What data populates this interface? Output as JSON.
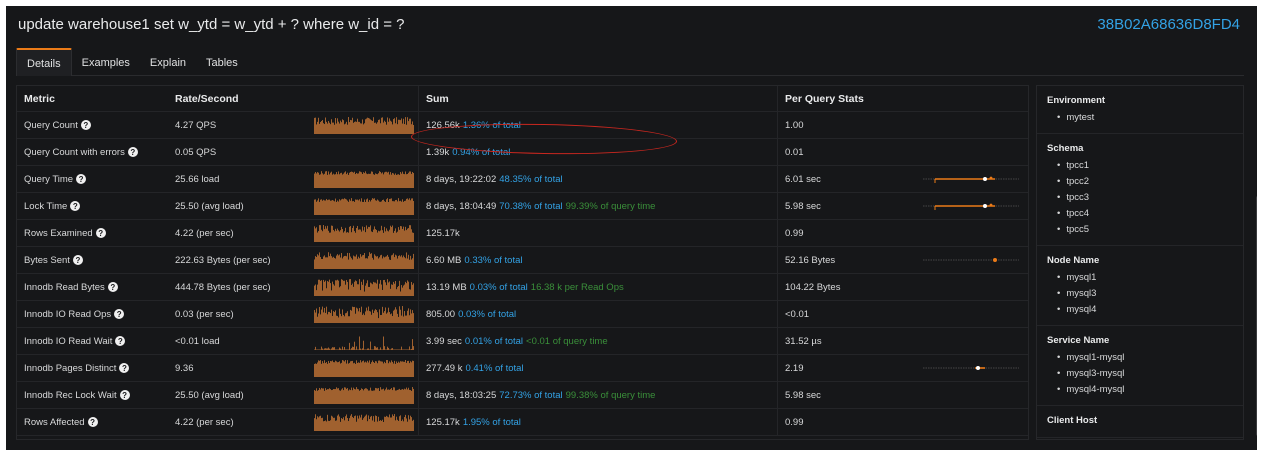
{
  "header": {
    "query_title": "update warehouse1 set w_ytd = w_ytd + ? where w_id = ?",
    "query_id": "38B02A68636D8FD4"
  },
  "tabs": [
    {
      "label": "Details",
      "active": true
    },
    {
      "label": "Examples",
      "active": false
    },
    {
      "label": "Explain",
      "active": false
    },
    {
      "label": "Tables",
      "active": false
    }
  ],
  "table": {
    "columns": {
      "metric": "Metric",
      "rate": "Rate/Second",
      "sum": "Sum",
      "per_query": "Per Query Stats"
    },
    "rows": [
      {
        "metric": "Query Count",
        "rate": "4.27 QPS",
        "sum": "126.56k",
        "sum_pct": "1.36% of total",
        "sum_extra": "",
        "per_query": "1.00",
        "sparkline": "dense",
        "pq_spark": null
      },
      {
        "metric": "Query Count with errors",
        "rate": "0.05 QPS",
        "sum": "1.39k",
        "sum_pct": "0.94% of total",
        "sum_extra": "",
        "per_query": "0.01",
        "sparkline": "none",
        "pq_spark": null
      },
      {
        "metric": "Query Time",
        "rate": "25.66 load",
        "sum": "8 days, 19:22:02",
        "sum_pct": "48.35% of total",
        "sum_extra": "",
        "per_query": "6.01 sec",
        "sparkline": "full",
        "pq_spark": "range_long"
      },
      {
        "metric": "Lock Time",
        "rate": "25.50 (avg load)",
        "sum": "8 days, 18:04:49",
        "sum_pct": "70.38% of total",
        "sum_extra": "99.39% of query time",
        "per_query": "5.98 sec",
        "sparkline": "full",
        "pq_spark": "range_long"
      },
      {
        "metric": "Rows Examined",
        "rate": "4.22 (per sec)",
        "sum": "125.17k",
        "sum_pct": "",
        "sum_extra": "",
        "per_query": "0.99",
        "sparkline": "dense",
        "pq_spark": null
      },
      {
        "metric": "Bytes Sent",
        "rate": "222.63 Bytes (per sec)",
        "sum": "6.60 MB",
        "sum_pct": "0.33% of total",
        "sum_extra": "",
        "per_query": "52.16 Bytes",
        "sparkline": "dense",
        "pq_spark": "point_right"
      },
      {
        "metric": "Innodb Read Bytes",
        "rate": "444.78 Bytes (per sec)",
        "sum": "13.19 MB",
        "sum_pct": "0.03% of total",
        "sum_extra": "16.38 k per Read Ops",
        "per_query": "104.22 Bytes",
        "sparkline": "spiky",
        "pq_spark": null
      },
      {
        "metric": "Innodb IO Read Ops",
        "rate": "0.03 (per sec)",
        "sum": "805.00",
        "sum_pct": "0.03% of total",
        "sum_extra": "",
        "per_query": "<0.01",
        "sparkline": "spiky",
        "pq_spark": null
      },
      {
        "metric": "Innodb IO Read Wait",
        "rate": "<0.01 load",
        "sum": "3.99 sec",
        "sum_pct": "0.01% of total",
        "sum_extra": "<0.01 of query time",
        "per_query": "31.52 µs",
        "sparkline": "sparse",
        "pq_spark": null
      },
      {
        "metric": "Innodb Pages Distinct",
        "rate": "9.36",
        "sum": "277.49 k",
        "sum_pct": "0.41% of total",
        "sum_extra": "",
        "per_query": "2.19",
        "sparkline": "full",
        "pq_spark": "point_mid"
      },
      {
        "metric": "Innodb Rec Lock Wait",
        "rate": "25.50 (avg load)",
        "sum": "8 days, 18:03:25",
        "sum_pct": "72.73% of total",
        "sum_extra": "99.38% of query time",
        "per_query": "5.98 sec",
        "sparkline": "full",
        "pq_spark": null
      },
      {
        "metric": "Rows Affected",
        "rate": "4.22 (per sec)",
        "sum": "125.17k",
        "sum_pct": "1.95% of total",
        "sum_extra": "",
        "per_query": "0.99",
        "sparkline": "dense",
        "pq_spark": null
      }
    ]
  },
  "sidebar": [
    {
      "title": "Environment",
      "items": [
        "mytest"
      ]
    },
    {
      "title": "Schema",
      "items": [
        "tpcc1",
        "tpcc2",
        "tpcc3",
        "tpcc4",
        "tpcc5"
      ]
    },
    {
      "title": "Node Name",
      "items": [
        "mysql1",
        "mysql3",
        "mysql4"
      ]
    },
    {
      "title": "Service Name",
      "items": [
        "mysql1-mysql",
        "mysql3-mysql",
        "mysql4-mysql"
      ]
    },
    {
      "title": "Client Host",
      "items": []
    }
  ],
  "colors": {
    "sparkline_fill": "#a0612f",
    "sparkline_top": "#c17a3f",
    "percent_text": "#33a2e5",
    "extra_text": "#3a8f3a",
    "annotation": "#c8271f",
    "tab_accent": "#eb7b18"
  },
  "icons": {
    "help": "question-circle-icon"
  }
}
